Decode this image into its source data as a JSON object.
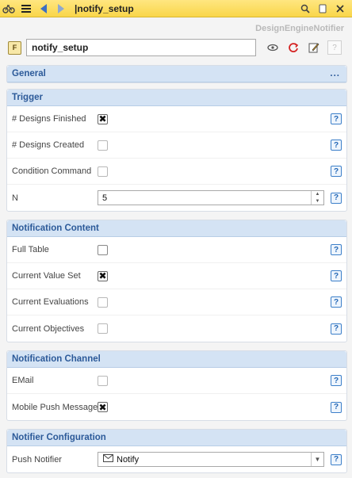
{
  "titlebar": {
    "title": "notify_setup",
    "icons": [
      "bike-icon",
      "menu-icon",
      "back-arrow-icon",
      "forward-arrow-icon",
      "search-icon",
      "copy-icon",
      "close-icon"
    ]
  },
  "node": {
    "type_badge": "F",
    "class_name": "DesignEngineNotifier",
    "name_value": "notify_setup",
    "help": "?"
  },
  "sections": {
    "general": {
      "title": "General",
      "more": "..."
    },
    "trigger": {
      "title": "Trigger",
      "rows": [
        {
          "label": "# Designs Finished",
          "checked": true,
          "mark": "✖"
        },
        {
          "label": "# Designs Created",
          "checked": false,
          "mark": ""
        },
        {
          "label": "Condition Command",
          "checked": false,
          "mark": ""
        },
        {
          "label": "N",
          "value": "5"
        }
      ]
    },
    "content": {
      "title": "Notification Content",
      "rows": [
        {
          "label": "Full Table",
          "mark": ""
        },
        {
          "label": "Current Value Set",
          "mark": "✖"
        },
        {
          "label": "Current Evaluations",
          "mark": ""
        },
        {
          "label": "Current Objectives",
          "mark": ""
        }
      ]
    },
    "channel": {
      "title": "Notification Channel",
      "rows": [
        {
          "label": "EMail",
          "mark": ""
        },
        {
          "label": "Mobile Push Message",
          "mark": "✖"
        }
      ]
    },
    "config": {
      "title": "Notifier Configuration",
      "rows": [
        {
          "label": "Push Notifier",
          "value": "Notify"
        }
      ]
    }
  },
  "help_label": "?"
}
